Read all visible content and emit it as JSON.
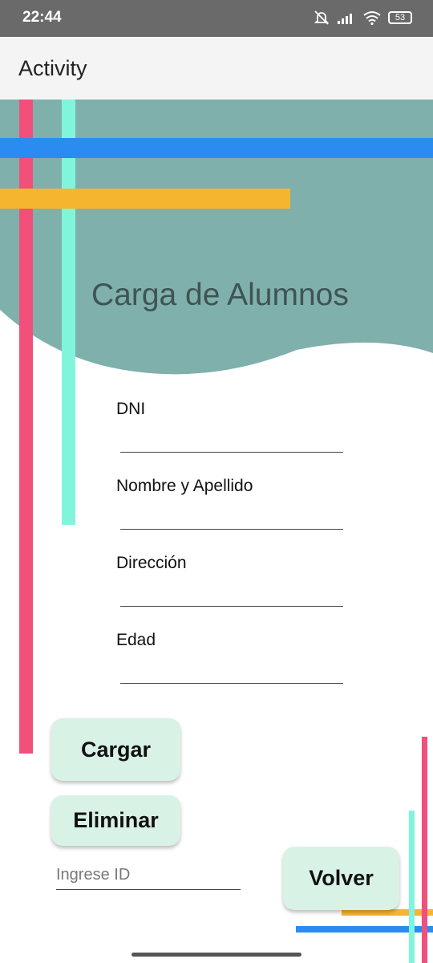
{
  "status_bar": {
    "time": "22:44",
    "battery": "53"
  },
  "app_bar": {
    "title": "Activity"
  },
  "header": {
    "title": "Carga de Alumnos"
  },
  "form": {
    "fields": [
      {
        "label": "DNI",
        "value": ""
      },
      {
        "label": "Nombre y Apellido",
        "value": ""
      },
      {
        "label": "Dirección",
        "value": ""
      },
      {
        "label": "Edad",
        "value": ""
      }
    ]
  },
  "actions": {
    "cargar_label": "Cargar",
    "eliminar_label": "Eliminar",
    "volver_label": "Volver",
    "id_placeholder": "Ingrese ID",
    "id_value": ""
  },
  "colors": {
    "teal_background": "#7fb0ac",
    "blue_stripe": "#2a8cf0",
    "orange_stripe": "#f6b52e",
    "pink_stripe": "#f0507a",
    "mint_stripe": "#80f5dc",
    "button_background": "#d9f2e6"
  }
}
